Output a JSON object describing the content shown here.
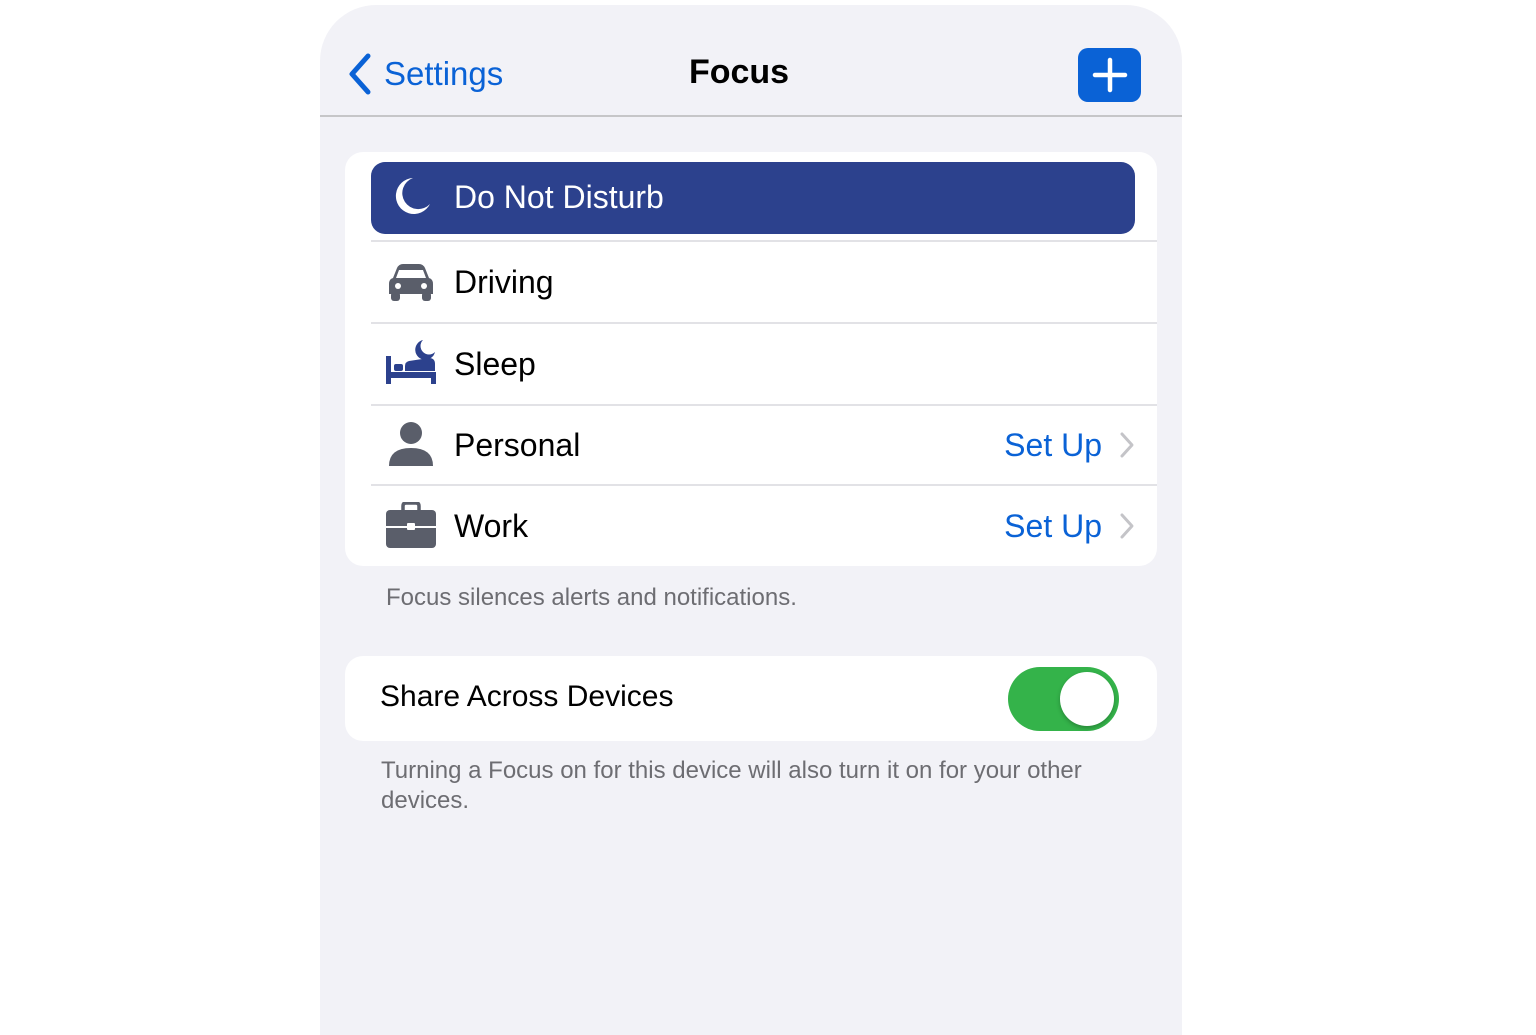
{
  "nav": {
    "back_label": "Settings",
    "title": "Focus",
    "add_icon": "plus-icon"
  },
  "colors": {
    "accent": "#0a62d6",
    "selected_row": "#2c418d",
    "toggle_on": "#34b34a",
    "background": "#f2f2f7"
  },
  "focus_modes": [
    {
      "label": "Do Not Disturb",
      "icon": "moon-icon",
      "selected": true
    },
    {
      "label": "Driving",
      "icon": "car-icon"
    },
    {
      "label": "Sleep",
      "icon": "bed-icon"
    },
    {
      "label": "Personal",
      "icon": "person-icon",
      "detail": "Set Up"
    },
    {
      "label": "Work",
      "icon": "briefcase-icon",
      "detail": "Set Up"
    }
  ],
  "focus_footer": "Focus silences alerts and notifications.",
  "share": {
    "label": "Share Across Devices",
    "enabled": true,
    "footer": "Turning a Focus on for this device will also turn it on for your other devices."
  }
}
